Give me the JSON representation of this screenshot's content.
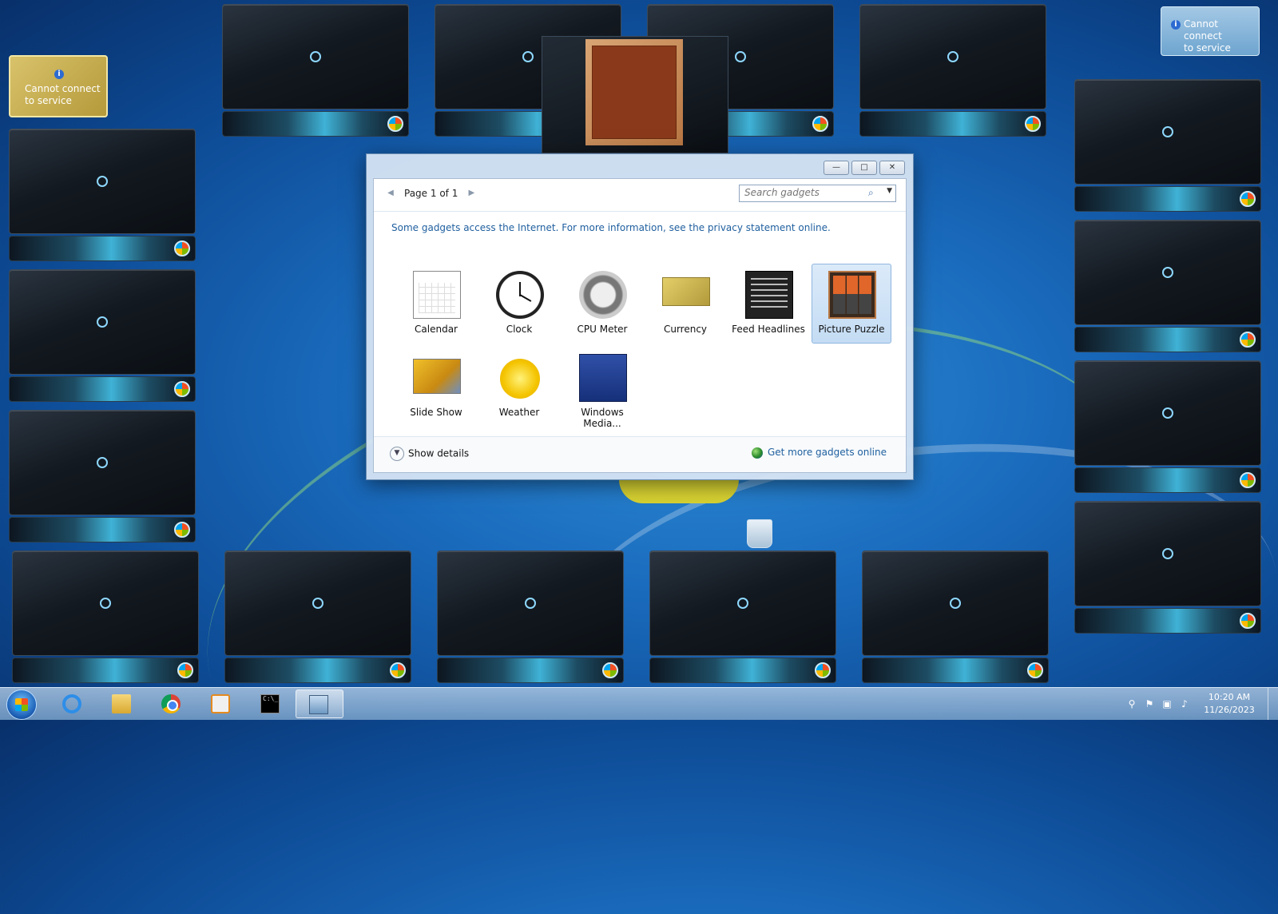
{
  "desktop": {
    "notice_text_line1": "Cannot connect",
    "notice_text_line2": "to service",
    "yellow_gadget_line1": "Cannot connect",
    "yellow_gadget_line2": "to service"
  },
  "dialog": {
    "pager_label": "Page 1 of 1",
    "search_placeholder": "Search gadgets",
    "privacy_text": "Some gadgets access the Internet.  For more information, see the privacy statement online.",
    "items": [
      {
        "name": "Calendar",
        "icon": "calendar-icon"
      },
      {
        "name": "Clock",
        "icon": "clock-icon"
      },
      {
        "name": "CPU Meter",
        "icon": "cpu-meter-icon"
      },
      {
        "name": "Currency",
        "icon": "currency-icon"
      },
      {
        "name": "Feed Headlines",
        "icon": "feed-headlines-icon"
      },
      {
        "name": "Picture Puzzle",
        "icon": "picture-puzzle-icon",
        "selected": true
      },
      {
        "name": "Slide Show",
        "icon": "slide-show-icon"
      },
      {
        "name": "Weather",
        "icon": "weather-icon"
      },
      {
        "name": "Windows Media...",
        "icon": "windows-media-icon"
      }
    ],
    "show_details": "Show details",
    "get_more": "Get more gadgets online",
    "win_buttons": {
      "minimize": "—",
      "maximize": "□",
      "close": "✕"
    }
  },
  "taskbar": {
    "time": "10:20 AM",
    "date": "11/26/2023",
    "apps": [
      {
        "name": "Internet Explorer",
        "icon": "internet-explorer-icon"
      },
      {
        "name": "Windows Explorer",
        "icon": "folder-icon"
      },
      {
        "name": "Google Chrome",
        "icon": "chrome-icon"
      },
      {
        "name": "Windows Media Player",
        "icon": "media-player-icon"
      },
      {
        "name": "Command Prompt",
        "icon": "command-prompt-icon"
      },
      {
        "name": "Gadgets",
        "icon": "gadgets-icon",
        "active": true
      }
    ],
    "tray_icons": [
      "search-icon",
      "flag-icon",
      "network-icon",
      "volume-icon"
    ]
  },
  "colors": {
    "link": "#1f5f9f",
    "selected_bg": "#c4dcf4"
  }
}
